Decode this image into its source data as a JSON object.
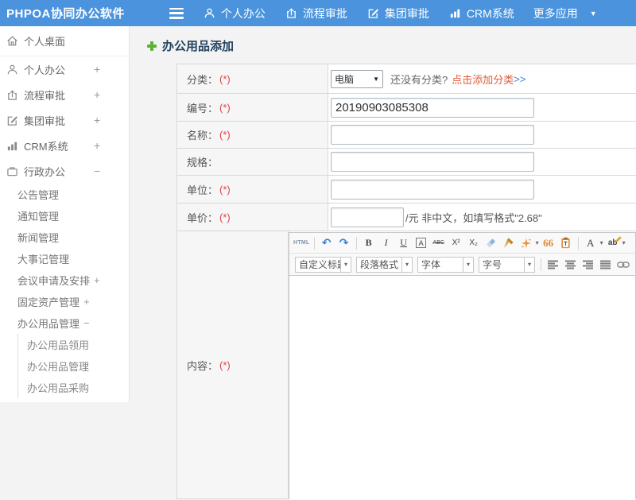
{
  "navbar": {
    "logo": "PHPOA协同办公软件",
    "items": [
      {
        "label": "个人办公",
        "icon": "user-icon"
      },
      {
        "label": "流程审批",
        "icon": "flow-icon"
      },
      {
        "label": "集团审批",
        "icon": "edit-icon"
      },
      {
        "label": "CRM系统",
        "icon": "chart-icon"
      }
    ],
    "more": {
      "label": "更多应用",
      "caret": "▼"
    }
  },
  "sidebar": {
    "items": [
      {
        "label": "个人桌面",
        "icon": "home-icon",
        "expand": ""
      },
      {
        "label": "个人办公",
        "icon": "user-icon",
        "expand": "+"
      },
      {
        "label": "流程审批",
        "icon": "flow-icon",
        "expand": "+"
      },
      {
        "label": "集团审批",
        "icon": "edit-icon",
        "expand": "+"
      },
      {
        "label": "CRM系统",
        "icon": "chart-icon",
        "expand": "+"
      },
      {
        "label": "行政办公",
        "icon": "briefcase-icon",
        "expand": "−"
      }
    ],
    "admin_children": [
      {
        "label": "公告管理",
        "expand": ""
      },
      {
        "label": "通知管理",
        "expand": ""
      },
      {
        "label": "新闻管理",
        "expand": ""
      },
      {
        "label": "大事记管理",
        "expand": ""
      },
      {
        "label": "会议申请及安排",
        "expand": "+"
      },
      {
        "label": "固定资产管理",
        "expand": "+"
      },
      {
        "label": "办公用品管理",
        "expand": "−"
      }
    ],
    "supplies_children": [
      {
        "label": "办公用品领用"
      },
      {
        "label": "办公用品管理"
      },
      {
        "label": "办公用品采购"
      }
    ]
  },
  "main": {
    "page_title": "办公用品添加",
    "form": {
      "category": {
        "label": "分类：",
        "required": "(*)",
        "selected": "电脑",
        "select_caret": "▼",
        "hint": "还没有分类?",
        "add_link": "点击添加分类",
        "arrows": ">>"
      },
      "code": {
        "label": "编号：",
        "required": "(*)",
        "value": "20190903085308"
      },
      "name": {
        "label": "名称：",
        "required": "(*)",
        "value": ""
      },
      "spec": {
        "label": "规格：",
        "value": ""
      },
      "unit": {
        "label": "单位：",
        "required": "(*)",
        "value": ""
      },
      "price": {
        "label": "单价：",
        "required": "(*)",
        "value": "",
        "suffix": "/元 非中文，如填写格式\"2.68\""
      },
      "content": {
        "label": "内容：",
        "required": "(*)"
      }
    },
    "editor": {
      "buttons": {
        "html": "HTML",
        "undo": "↶",
        "redo": "↷",
        "bold": "B",
        "italic": "I",
        "underline": "U",
        "char_border": "A",
        "strike": "ABC",
        "sup": "X²",
        "sub": "X₂",
        "quote": "66",
        "font_color": "A",
        "highlight": "ab",
        "caret": "▾"
      },
      "dropdowns": [
        {
          "label": "自定义标题"
        },
        {
          "label": "段落格式"
        },
        {
          "label": "字体"
        },
        {
          "label": "字号"
        }
      ]
    }
  },
  "colors": {
    "navbar_blue": "#4b94dd",
    "title_navy": "#24425f",
    "required_red": "#e24444",
    "add_link_red": "#e05a3a",
    "link_blue": "#3c7fd8",
    "plus_green": "#5fb234"
  }
}
